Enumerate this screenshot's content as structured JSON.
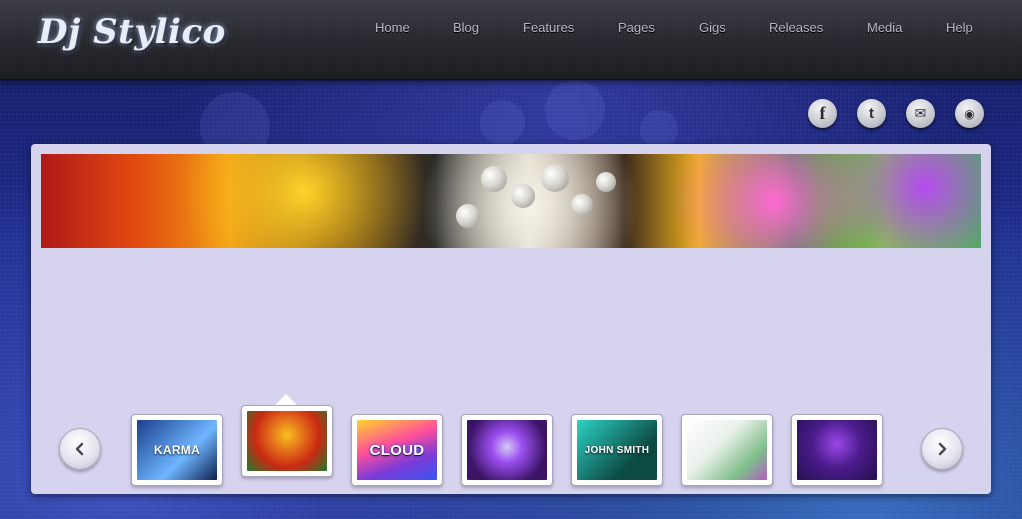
{
  "site": {
    "logo_text": "Dj Stylico"
  },
  "nav": {
    "items": [
      {
        "label": "Home"
      },
      {
        "label": "Blog"
      },
      {
        "label": "Features"
      },
      {
        "label": "Pages"
      },
      {
        "label": "Gigs"
      },
      {
        "label": "Releases"
      },
      {
        "label": "Media"
      },
      {
        "label": "Help"
      }
    ]
  },
  "social": [
    {
      "icon": "facebook-icon",
      "glyph": "f"
    },
    {
      "icon": "twitter-icon",
      "glyph": "t"
    },
    {
      "icon": "mail-icon",
      "glyph": "✉"
    },
    {
      "icon": "rss-icon",
      "glyph": "◉"
    }
  ],
  "slider": {
    "prev_icon": "chevron-left-icon",
    "next_icon": "chevron-right-icon",
    "active_index": 1,
    "thumbs": [
      {
        "title": "KARMA",
        "colors": [
          "#1b3e8c",
          "#6fb6ff"
        ]
      },
      {
        "title": "",
        "colors": [
          "#c82a12",
          "#f7c21e"
        ]
      },
      {
        "title": "CLOUD",
        "colors": [
          "#ff4f9a",
          "#3a56f0"
        ]
      },
      {
        "title": "",
        "colors": [
          "#3b1466",
          "#c04ef0"
        ]
      },
      {
        "title": "JOHN SMITH",
        "colors": [
          "#0c4a44",
          "#2ed3c4"
        ]
      },
      {
        "title": "",
        "colors": [
          "#e9f1ea",
          "#7fbe8a"
        ]
      },
      {
        "title": "",
        "colors": [
          "#24104f",
          "#9b48e8"
        ]
      }
    ]
  },
  "colors": {
    "panel": "#d6d3ef",
    "header": "#26272d",
    "nav_text": "#b4b7c0"
  }
}
